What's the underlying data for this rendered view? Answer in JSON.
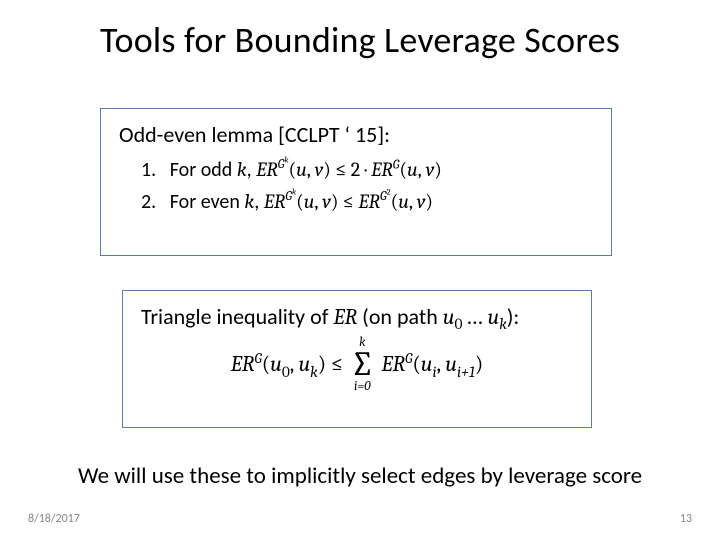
{
  "title": "Tools for Bounding Leverage Scores",
  "lemma": {
    "heading_pre": "Odd-even lemma [CCLPT ",
    "heading_apos": "‘",
    "heading_year": " 15]:",
    "item1_num": "1.",
    "item1_pre": "For odd ",
    "item1_k": "k",
    "item1_sep": ", ",
    "item1_lhs_ER": "ER",
    "item1_lhs_G": "G",
    "item1_lhs_supk": "k",
    "item1_lhs_paren_open": "(",
    "item1_lhs_u": "u",
    "item1_lhs_comma": ", ",
    "item1_lhs_v": "v",
    "item1_lhs_paren_close": ")",
    "item1_le": " ≤ 2 · ",
    "item1_rhs_ER": "ER",
    "item1_rhs_G": "G",
    "item1_rhs_paren_open": "(",
    "item1_rhs_u": "u",
    "item1_rhs_comma": ", ",
    "item1_rhs_v": "v",
    "item1_rhs_paren_close": ")",
    "item2_num": "2.",
    "item2_pre": "For even ",
    "item2_k": "k",
    "item2_sep": ", ",
    "item2_lhs_ER": "ER",
    "item2_lhs_G": "G",
    "item2_lhs_supk": "k",
    "item2_lhs_paren_open": "(",
    "item2_lhs_u": "u",
    "item2_lhs_comma": ", ",
    "item2_lhs_v": "v",
    "item2_lhs_paren_close": ")",
    "item2_le": " ≤ ",
    "item2_rhs_ER": "ER",
    "item2_rhs_G": "G",
    "item2_rhs_sup2": "2",
    "item2_rhs_paren_open": "(",
    "item2_rhs_u": "u",
    "item2_rhs_comma": ", ",
    "item2_rhs_v": "v",
    "item2_rhs_paren_close": ")"
  },
  "triangle": {
    "heading_pre": "Triangle inequality of ",
    "heading_ER": "ER",
    "heading_mid": " (on path ",
    "heading_u0_u": "u",
    "heading_u0_0": "0",
    "heading_dots": " … ",
    "heading_uk_u": "u",
    "heading_uk_k": "k",
    "heading_close": "):",
    "lhs_ER": "ER",
    "lhs_G": "G",
    "lhs_open": "(",
    "lhs_u": "u",
    "lhs_0": "0",
    "lhs_comma": ", ",
    "lhs_u2": "u",
    "lhs_k": "k",
    "lhs_close": ")",
    "le": " ≤ ",
    "sum_top": "k",
    "sum_bot": "i=0",
    "rhs_ER": "ER",
    "rhs_G": "G",
    "rhs_open": "(",
    "rhs_u": "u",
    "rhs_i": "i",
    "rhs_comma": ", ",
    "rhs_u2": "u",
    "rhs_ip1": "i+1",
    "rhs_close": ")"
  },
  "conclusion": "We will use these to implicitly select edges by leverage score",
  "footer": {
    "date": "8/18/2017",
    "page": "13"
  }
}
